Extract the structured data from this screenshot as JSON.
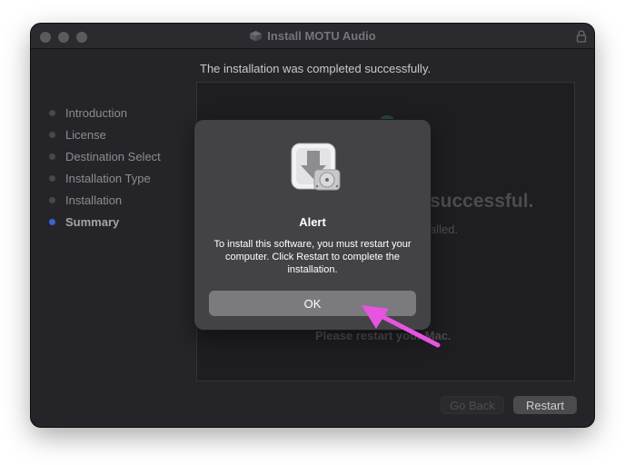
{
  "window": {
    "title": "Install MOTU Audio",
    "heading": "The installation was completed successfully."
  },
  "sidebar": {
    "steps": [
      {
        "label": "Introduction",
        "current": false
      },
      {
        "label": "License",
        "current": false
      },
      {
        "label": "Destination Select",
        "current": false
      },
      {
        "label": "Installation Type",
        "current": false
      },
      {
        "label": "Installation",
        "current": false
      },
      {
        "label": "Summary",
        "current": true
      }
    ]
  },
  "content": {
    "success_partial": "successful.",
    "installed_partial": "alled.",
    "restart_prompt": "Please restart your Mac."
  },
  "footer": {
    "go_back_label": "Go Back",
    "restart_label": "Restart"
  },
  "alert": {
    "icon": "installer-package-icon",
    "title": "Alert",
    "message": "To install this software, you must restart your computer. Click Restart to complete the installation.",
    "ok_label": "OK"
  },
  "annotation": {
    "icon": "pointer-arrow",
    "color": "#e754e0"
  },
  "colors": {
    "window_bg": "#252428",
    "alert_bg": "#434246",
    "accent": "#3b63d6"
  }
}
